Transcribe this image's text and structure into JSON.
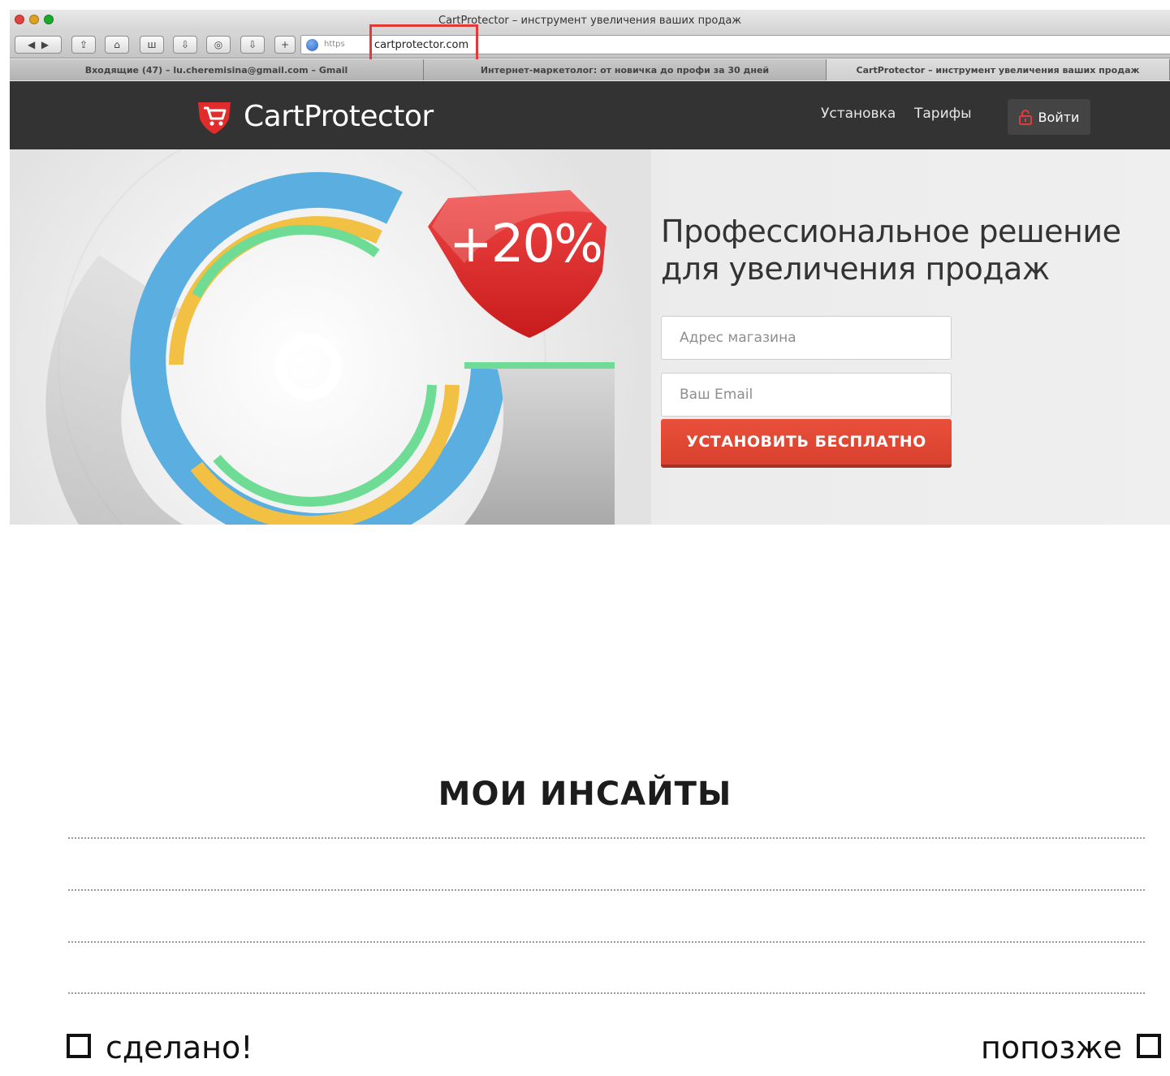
{
  "browser": {
    "window_title": "CartProtector – инструмент увеличения ваших продаж",
    "url_prefix": "https",
    "url": "cartprotector.com",
    "tabs": [
      {
        "label": "Входящие (47) – lu.cheremisina@gmail.com – Gmail",
        "active": false
      },
      {
        "label": "Интернет-маркетолог: от новичка до профи за 30 дней",
        "active": false
      },
      {
        "label": "CartProtector – инструмент увеличения ваших продаж",
        "active": true
      }
    ]
  },
  "site": {
    "logo_text": "CartProtector",
    "nav": [
      "Установка",
      "Тарифы"
    ],
    "login_label": "Войти",
    "badge_text": "+20%",
    "hero_title_line1": "Профессиональное решение",
    "hero_title_line2": "для увеличения продаж",
    "shop_placeholder": "Адрес магазина",
    "email_placeholder": "Ваш Email",
    "cta_label": "УСТАНОВИТЬ БЕСПЛАТНО",
    "colors": {
      "header": "#333333",
      "cta": "#e24a36",
      "accent_red": "#e02a2a",
      "ring_blue": "#5aaee0",
      "ring_yellow": "#f2c043",
      "ring_green": "#6fdc95"
    }
  },
  "worksheet": {
    "title": "МОИ ИНСАЙТЫ",
    "done_label": "сделано!",
    "later_label": "попозже"
  }
}
